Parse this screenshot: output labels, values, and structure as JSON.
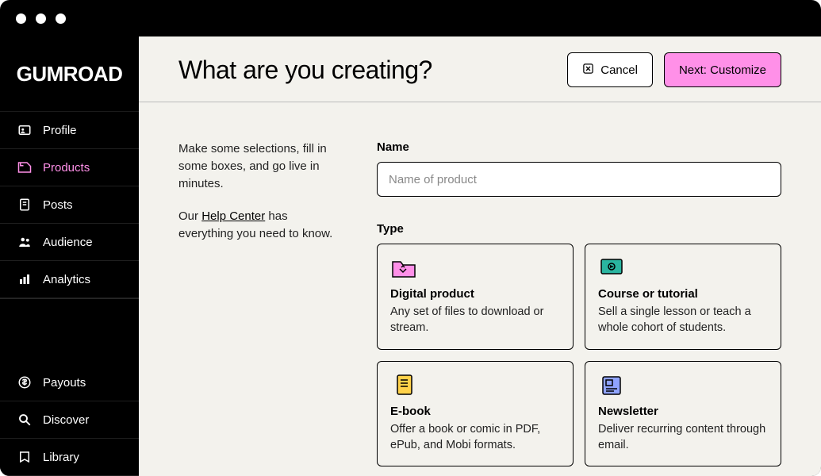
{
  "logo": "GUMROAD",
  "sidebar": {
    "items": [
      {
        "label": "Profile"
      },
      {
        "label": "Products"
      },
      {
        "label": "Posts"
      },
      {
        "label": "Audience"
      },
      {
        "label": "Analytics"
      },
      {
        "label": "Payouts"
      },
      {
        "label": "Discover"
      },
      {
        "label": "Library"
      }
    ]
  },
  "header": {
    "title": "What are you creating?",
    "cancel": "Cancel",
    "next": "Next: Customize"
  },
  "intro": {
    "p1": "Make some selections, fill in some boxes, and go live in minutes.",
    "p2_pre": "Our ",
    "p2_link": "Help Center",
    "p2_post": " has everything you need to know."
  },
  "form": {
    "name_label": "Name",
    "name_placeholder": "Name of product",
    "type_label": "Type",
    "types": [
      {
        "title": "Digital product",
        "desc": "Any set of files to download or stream."
      },
      {
        "title": "Course or tutorial",
        "desc": "Sell a single lesson or teach a whole cohort of students."
      },
      {
        "title": "E-book",
        "desc": "Offer a book or comic in PDF, ePub, and Mobi formats."
      },
      {
        "title": "Newsletter",
        "desc": "Deliver recurring content through email."
      }
    ]
  }
}
